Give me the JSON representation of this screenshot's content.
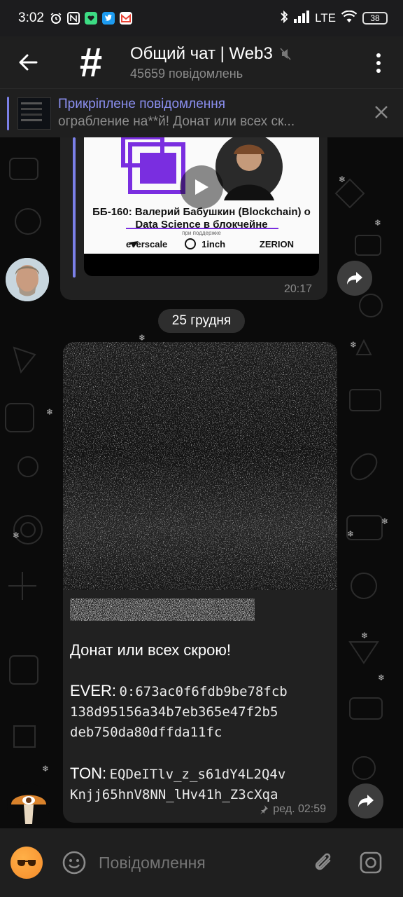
{
  "status_bar": {
    "time": "3:02",
    "network": "LTE",
    "battery": "38"
  },
  "header": {
    "title": "Общий чат | Web3",
    "subtitle": "45659 повідомлень",
    "avatar_glyph": "#"
  },
  "pinned": {
    "title": "Прикріплене повідомлення",
    "message": "ограбление на**й!   Донат или всех ск..."
  },
  "video_post": {
    "caption_line1": "ББ-160: Валерий Бабушкин (Blockchain) о",
    "caption_line2": "Data Science в блокчейне",
    "support_text": "при поддержке",
    "sponsors": [
      "everscale",
      "1inch",
      "ZERION"
    ],
    "time": "20:17"
  },
  "date_separator": "25 грудня",
  "message": {
    "line1": "Донат или всех скрою!",
    "ever_label": "EVER:",
    "ever_addr_1": "0:673ac0f6fdb9be78fcb",
    "ever_addr_2": "138d95156a34b7eb365e47f2b5",
    "ever_addr_3": "deb750da80dffda11fc",
    "ton_label": "TON:",
    "ton_addr_1": "EQDeITlv_z_s61dY4L2Q4v",
    "ton_addr_2": "Knjj65hnV8NN_lHv41h_Z3cXqa",
    "meta": "ред. 02:59"
  },
  "input": {
    "placeholder": "Повідомлення"
  },
  "colors": {
    "accent": "#7b80e8",
    "bubble": "#212121",
    "bar": "#1f1f1f",
    "muted": "#8a8a8a",
    "purple_logo": "#7a2ee0"
  }
}
